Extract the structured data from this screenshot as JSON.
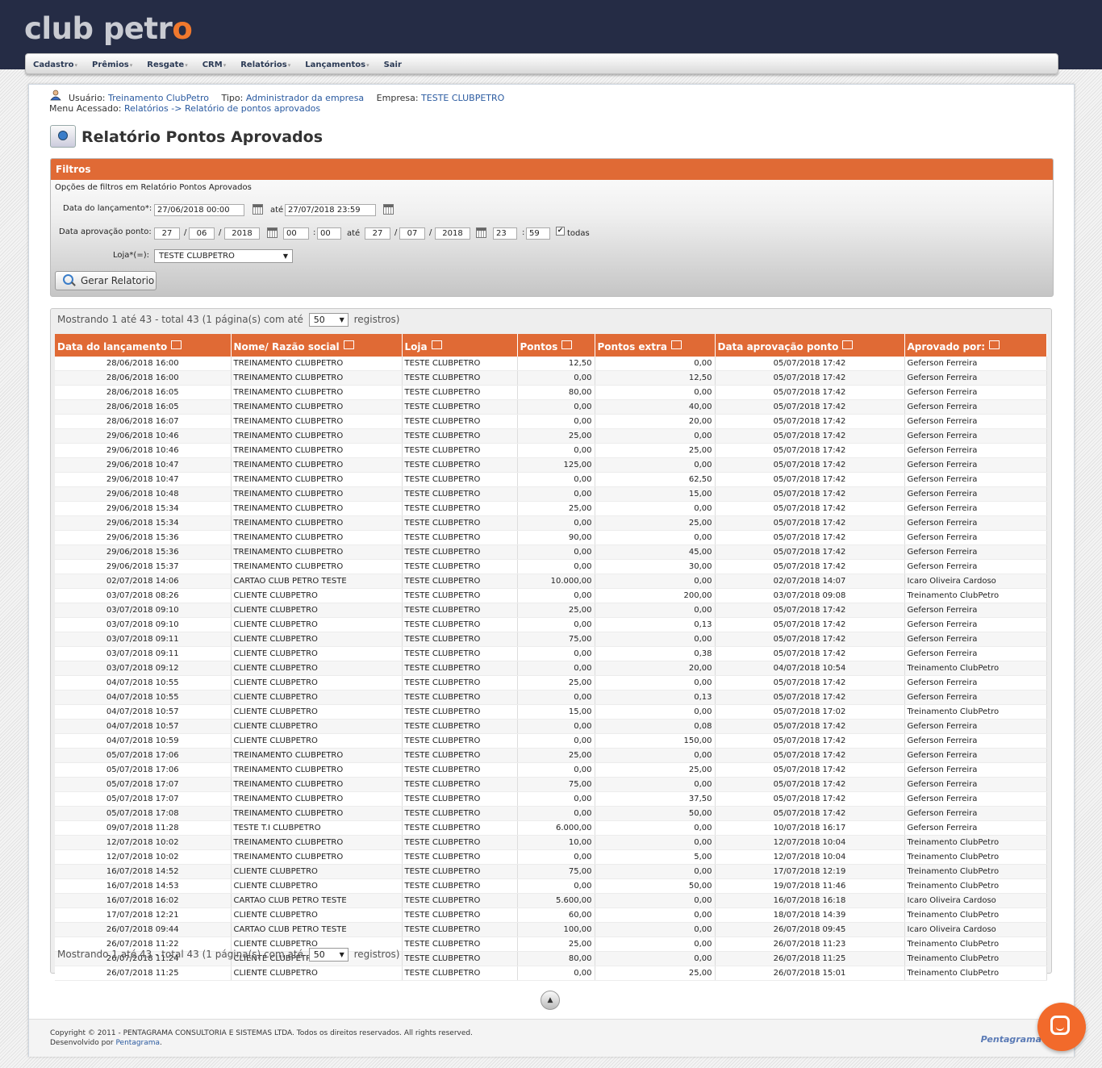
{
  "brand": {
    "logo_text_a": "club petr",
    "logo_text_b": "o",
    "accent": "#e06a35"
  },
  "nav": [
    "Cadastro",
    "Prêmios",
    "Resgate",
    "CRM",
    "Relatórios",
    "Lançamentos",
    "Sair"
  ],
  "user": {
    "usuario_label": "Usuário:",
    "usuario": "Treinamento ClubPetro",
    "tipo_label": "Tipo:",
    "tipo": "Administrador da empresa",
    "empresa_label": "Empresa:",
    "empresa": "TESTE CLUBPETRO",
    "menu_label": "Menu Acessado:",
    "menu": "Relatórios -> Relatório de pontos aprovados"
  },
  "page_title": "Relatório Pontos Aprovados",
  "filters": {
    "header": "Filtros",
    "subtitle": "Opções de filtros em Relatório Pontos Aprovados",
    "data_lancamento_label": "Data do lançamento*:",
    "data_lancamento_de": "27/06/2018 00:00",
    "ate_label": "até",
    "data_lancamento_ate": "27/07/2018 23:59",
    "data_aprovacao_label": "Data aprovação ponto:",
    "ap_de_dia": "27",
    "ap_de_mes": "06",
    "ap_de_ano": "2018",
    "ap_de_hora": "00",
    "ap_de_min": "00",
    "ap_ate_dia": "27",
    "ap_ate_mes": "07",
    "ap_ate_ano": "2018",
    "ap_ate_hora": "23",
    "ap_ate_min": "59",
    "slash": "/",
    "colon": ":",
    "todas_label": "todas",
    "todas_checked": "✔",
    "loja_label": "Loja*(=):",
    "loja_value": "TESTE CLUBPETRO",
    "submit_label": "Gerar Relatorio"
  },
  "pager": {
    "prefix": "Mostrando 1 até 43 - total 43 (1 página(s) com até",
    "per_page": "50",
    "suffix": "registros)"
  },
  "table": {
    "columns": [
      "Data do lançamento",
      "Nome/ Razão social",
      "Loja",
      "Pontos",
      "Pontos extra",
      "Data aprovação ponto",
      "Aprovado por:"
    ],
    "rows": [
      [
        "28/06/2018 16:00",
        "TREINAMENTO CLUBPETRO",
        "TESTE CLUBPETRO",
        "12,50",
        "0,00",
        "05/07/2018 17:42",
        "Geferson Ferreira"
      ],
      [
        "28/06/2018 16:00",
        "TREINAMENTO CLUBPETRO",
        "TESTE CLUBPETRO",
        "0,00",
        "12,50",
        "05/07/2018 17:42",
        "Geferson Ferreira"
      ],
      [
        "28/06/2018 16:05",
        "TREINAMENTO CLUBPETRO",
        "TESTE CLUBPETRO",
        "80,00",
        "0,00",
        "05/07/2018 17:42",
        "Geferson Ferreira"
      ],
      [
        "28/06/2018 16:05",
        "TREINAMENTO CLUBPETRO",
        "TESTE CLUBPETRO",
        "0,00",
        "40,00",
        "05/07/2018 17:42",
        "Geferson Ferreira"
      ],
      [
        "28/06/2018 16:07",
        "TREINAMENTO CLUBPETRO",
        "TESTE CLUBPETRO",
        "0,00",
        "20,00",
        "05/07/2018 17:42",
        "Geferson Ferreira"
      ],
      [
        "29/06/2018 10:46",
        "TREINAMENTO CLUBPETRO",
        "TESTE CLUBPETRO",
        "25,00",
        "0,00",
        "05/07/2018 17:42",
        "Geferson Ferreira"
      ],
      [
        "29/06/2018 10:46",
        "TREINAMENTO CLUBPETRO",
        "TESTE CLUBPETRO",
        "0,00",
        "25,00",
        "05/07/2018 17:42",
        "Geferson Ferreira"
      ],
      [
        "29/06/2018 10:47",
        "TREINAMENTO CLUBPETRO",
        "TESTE CLUBPETRO",
        "125,00",
        "0,00",
        "05/07/2018 17:42",
        "Geferson Ferreira"
      ],
      [
        "29/06/2018 10:47",
        "TREINAMENTO CLUBPETRO",
        "TESTE CLUBPETRO",
        "0,00",
        "62,50",
        "05/07/2018 17:42",
        "Geferson Ferreira"
      ],
      [
        "29/06/2018 10:48",
        "TREINAMENTO CLUBPETRO",
        "TESTE CLUBPETRO",
        "0,00",
        "15,00",
        "05/07/2018 17:42",
        "Geferson Ferreira"
      ],
      [
        "29/06/2018 15:34",
        "TREINAMENTO CLUBPETRO",
        "TESTE CLUBPETRO",
        "25,00",
        "0,00",
        "05/07/2018 17:42",
        "Geferson Ferreira"
      ],
      [
        "29/06/2018 15:34",
        "TREINAMENTO CLUBPETRO",
        "TESTE CLUBPETRO",
        "0,00",
        "25,00",
        "05/07/2018 17:42",
        "Geferson Ferreira"
      ],
      [
        "29/06/2018 15:36",
        "TREINAMENTO CLUBPETRO",
        "TESTE CLUBPETRO",
        "90,00",
        "0,00",
        "05/07/2018 17:42",
        "Geferson Ferreira"
      ],
      [
        "29/06/2018 15:36",
        "TREINAMENTO CLUBPETRO",
        "TESTE CLUBPETRO",
        "0,00",
        "45,00",
        "05/07/2018 17:42",
        "Geferson Ferreira"
      ],
      [
        "29/06/2018 15:37",
        "TREINAMENTO CLUBPETRO",
        "TESTE CLUBPETRO",
        "0,00",
        "30,00",
        "05/07/2018 17:42",
        "Geferson Ferreira"
      ],
      [
        "02/07/2018 14:06",
        "CARTAO CLUB PETRO TESTE",
        "TESTE CLUBPETRO",
        "10.000,00",
        "0,00",
        "02/07/2018 14:07",
        "Icaro Oliveira Cardoso"
      ],
      [
        "03/07/2018 08:26",
        "CLIENTE CLUBPETRO",
        "TESTE CLUBPETRO",
        "0,00",
        "200,00",
        "03/07/2018 09:08",
        "Treinamento ClubPetro"
      ],
      [
        "03/07/2018 09:10",
        "CLIENTE CLUBPETRO",
        "TESTE CLUBPETRO",
        "25,00",
        "0,00",
        "05/07/2018 17:42",
        "Geferson Ferreira"
      ],
      [
        "03/07/2018 09:10",
        "CLIENTE CLUBPETRO",
        "TESTE CLUBPETRO",
        "0,00",
        "0,13",
        "05/07/2018 17:42",
        "Geferson Ferreira"
      ],
      [
        "03/07/2018 09:11",
        "CLIENTE CLUBPETRO",
        "TESTE CLUBPETRO",
        "75,00",
        "0,00",
        "05/07/2018 17:42",
        "Geferson Ferreira"
      ],
      [
        "03/07/2018 09:11",
        "CLIENTE CLUBPETRO",
        "TESTE CLUBPETRO",
        "0,00",
        "0,38",
        "05/07/2018 17:42",
        "Geferson Ferreira"
      ],
      [
        "03/07/2018 09:12",
        "CLIENTE CLUBPETRO",
        "TESTE CLUBPETRO",
        "0,00",
        "20,00",
        "04/07/2018 10:54",
        "Treinamento ClubPetro"
      ],
      [
        "04/07/2018 10:55",
        "CLIENTE CLUBPETRO",
        "TESTE CLUBPETRO",
        "25,00",
        "0,00",
        "05/07/2018 17:42",
        "Geferson Ferreira"
      ],
      [
        "04/07/2018 10:55",
        "CLIENTE CLUBPETRO",
        "TESTE CLUBPETRO",
        "0,00",
        "0,13",
        "05/07/2018 17:42",
        "Geferson Ferreira"
      ],
      [
        "04/07/2018 10:57",
        "CLIENTE CLUBPETRO",
        "TESTE CLUBPETRO",
        "15,00",
        "0,00",
        "05/07/2018 17:02",
        "Treinamento ClubPetro"
      ],
      [
        "04/07/2018 10:57",
        "CLIENTE CLUBPETRO",
        "TESTE CLUBPETRO",
        "0,00",
        "0,08",
        "05/07/2018 17:42",
        "Geferson Ferreira"
      ],
      [
        "04/07/2018 10:59",
        "CLIENTE CLUBPETRO",
        "TESTE CLUBPETRO",
        "0,00",
        "150,00",
        "05/07/2018 17:42",
        "Geferson Ferreira"
      ],
      [
        "05/07/2018 17:06",
        "TREINAMENTO CLUBPETRO",
        "TESTE CLUBPETRO",
        "25,00",
        "0,00",
        "05/07/2018 17:42",
        "Geferson Ferreira"
      ],
      [
        "05/07/2018 17:06",
        "TREINAMENTO CLUBPETRO",
        "TESTE CLUBPETRO",
        "0,00",
        "25,00",
        "05/07/2018 17:42",
        "Geferson Ferreira"
      ],
      [
        "05/07/2018 17:07",
        "TREINAMENTO CLUBPETRO",
        "TESTE CLUBPETRO",
        "75,00",
        "0,00",
        "05/07/2018 17:42",
        "Geferson Ferreira"
      ],
      [
        "05/07/2018 17:07",
        "TREINAMENTO CLUBPETRO",
        "TESTE CLUBPETRO",
        "0,00",
        "37,50",
        "05/07/2018 17:42",
        "Geferson Ferreira"
      ],
      [
        "05/07/2018 17:08",
        "TREINAMENTO CLUBPETRO",
        "TESTE CLUBPETRO",
        "0,00",
        "50,00",
        "05/07/2018 17:42",
        "Geferson Ferreira"
      ],
      [
        "09/07/2018 11:28",
        "TESTE T.I CLUBPETRO",
        "TESTE CLUBPETRO",
        "6.000,00",
        "0,00",
        "10/07/2018 16:17",
        "Geferson Ferreira"
      ],
      [
        "12/07/2018 10:02",
        "TREINAMENTO CLUBPETRO",
        "TESTE CLUBPETRO",
        "10,00",
        "0,00",
        "12/07/2018 10:04",
        "Treinamento ClubPetro"
      ],
      [
        "12/07/2018 10:02",
        "TREINAMENTO CLUBPETRO",
        "TESTE CLUBPETRO",
        "0,00",
        "5,00",
        "12/07/2018 10:04",
        "Treinamento ClubPetro"
      ],
      [
        "16/07/2018 14:52",
        "CLIENTE CLUBPETRO",
        "TESTE CLUBPETRO",
        "75,00",
        "0,00",
        "17/07/2018 12:19",
        "Treinamento ClubPetro"
      ],
      [
        "16/07/2018 14:53",
        "CLIENTE CLUBPETRO",
        "TESTE CLUBPETRO",
        "0,00",
        "50,00",
        "19/07/2018 11:46",
        "Treinamento ClubPetro"
      ],
      [
        "16/07/2018 16:02",
        "CARTAO CLUB PETRO TESTE",
        "TESTE CLUBPETRO",
        "5.600,00",
        "0,00",
        "16/07/2018 16:18",
        "Icaro Oliveira Cardoso"
      ],
      [
        "17/07/2018 12:21",
        "CLIENTE CLUBPETRO",
        "TESTE CLUBPETRO",
        "60,00",
        "0,00",
        "18/07/2018 14:39",
        "Treinamento ClubPetro"
      ],
      [
        "26/07/2018 09:44",
        "CARTAO CLUB PETRO TESTE",
        "TESTE CLUBPETRO",
        "100,00",
        "0,00",
        "26/07/2018 09:45",
        "Icaro Oliveira Cardoso"
      ],
      [
        "26/07/2018 11:22",
        "CLIENTE CLUBPETRO",
        "TESTE CLUBPETRO",
        "25,00",
        "0,00",
        "26/07/2018 11:23",
        "Treinamento ClubPetro"
      ],
      [
        "26/07/2018 11:24",
        "CLIENTE CLUBPETRO",
        "TESTE CLUBPETRO",
        "80,00",
        "0,00",
        "26/07/2018 11:25",
        "Treinamento ClubPetro"
      ],
      [
        "26/07/2018 11:25",
        "CLIENTE CLUBPETRO",
        "TESTE CLUBPETRO",
        "0,00",
        "25,00",
        "26/07/2018 15:01",
        "Treinamento ClubPetro"
      ]
    ]
  },
  "footer": {
    "copyright": "Copyright © 2011 - PENTAGRAMA CONSULTORIA E SISTEMAS LTDA. Todos os direitos reservados. All rights reserved.",
    "dev_prefix": "Desenvolvido por",
    "dev_name": "Pentagrama",
    "dev_suffix": ".",
    "badge": "Pentagrama"
  }
}
